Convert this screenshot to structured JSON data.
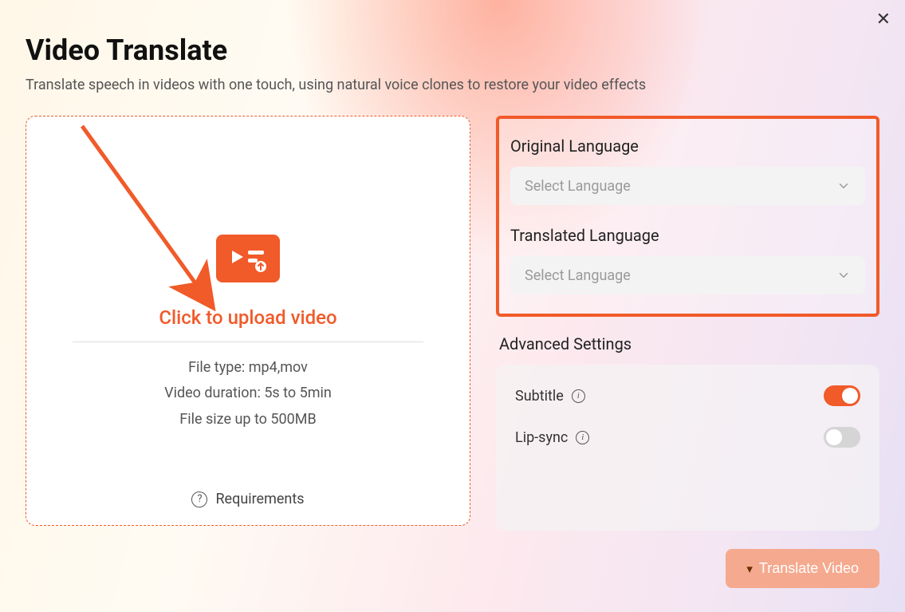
{
  "header": {
    "title": "Video Translate",
    "subtitle": "Translate speech in videos with one touch, using natural voice clones to restore your video effects"
  },
  "upload": {
    "cta": "Click to upload video",
    "specs": {
      "file_type": "File type: mp4,mov",
      "duration": "Video duration: 5s to 5min",
      "size": "File size up to  500MB"
    },
    "requirements_label": "Requirements"
  },
  "languages": {
    "original_label": "Original Language",
    "translated_label": "Translated Language",
    "placeholder": "Select Language"
  },
  "advanced": {
    "title": "Advanced Settings",
    "subtitle_label": "Subtitle",
    "lipsync_label": "Lip-sync",
    "subtitle_on": true,
    "lipsync_on": false
  },
  "actions": {
    "translate": "Translate Video"
  },
  "colors": {
    "accent": "#f15a29"
  }
}
